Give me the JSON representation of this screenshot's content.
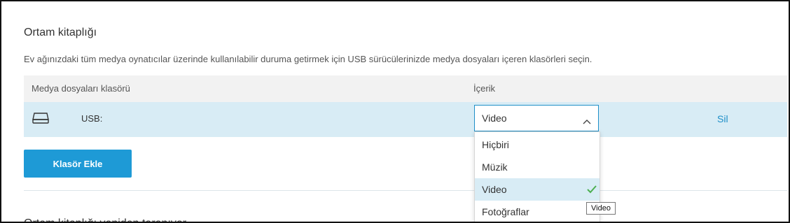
{
  "section": {
    "title": "Ortam kitaplığı",
    "description": "Ev ağınızdaki tüm medya oynatıcılar üzerinde kullanılabilir duruma getirmek için USB sürücülerinizde medya dosyaları içeren klasörleri seçin."
  },
  "table": {
    "headers": {
      "folder": "Medya dosyaları klasörü",
      "content": "İçerik"
    },
    "rows": [
      {
        "icon": "hard-drive-icon",
        "folder": "USB:",
        "content": "Video",
        "delete": "Sil"
      }
    ]
  },
  "dropdown": {
    "options": [
      "Hiçbiri",
      "Müzik",
      "Video",
      "Fotoğraflar"
    ],
    "selected": "Video",
    "tooltip": "Video"
  },
  "buttons": {
    "add_folder": "Klasör Ekle"
  },
  "next_section": {
    "title": "Ortam kitaplığı yeniden taranıyor"
  },
  "colors": {
    "accent": "#1e9ad6",
    "row_highlight": "#d8ecf5",
    "check": "#4caf50"
  }
}
